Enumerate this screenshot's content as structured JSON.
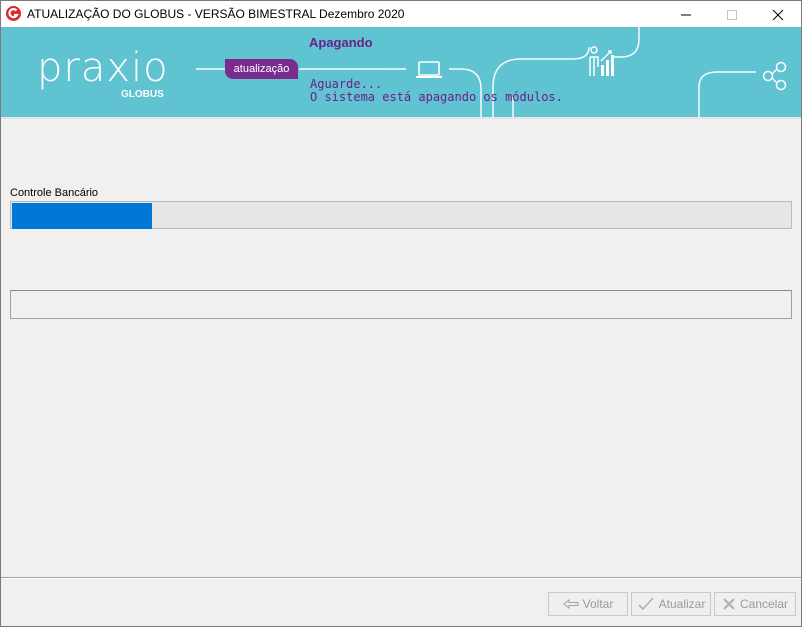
{
  "window": {
    "title": "ATUALIZAÇÃO DO GLOBUS - VERSÃO BIMESTRAL Dezembro 2020"
  },
  "banner": {
    "logo": "praxio",
    "logo_sub": "GLOBUS",
    "step_label": "atualização",
    "status_title": "Apagando",
    "status_lines": [
      "Aguarde...",
      "O sistema está apagando os módulos."
    ],
    "background_color": "#5fc3d1",
    "accent_color": "#7a2c8e"
  },
  "progress": {
    "label": "Controle Bancário",
    "fraction": 0.18,
    "fill_color": "#0078d7"
  },
  "log": {
    "text": ""
  },
  "buttons": {
    "back": "Voltar",
    "update": "Atualizar",
    "cancel": "Cancelar"
  },
  "icons": [
    "app-logo-icon",
    "minimize-icon",
    "maximize-icon",
    "close-icon",
    "laptop-icon",
    "chart-person-icon",
    "share-icon",
    "back-arrow-icon",
    "check-icon",
    "cancel-x-icon"
  ]
}
